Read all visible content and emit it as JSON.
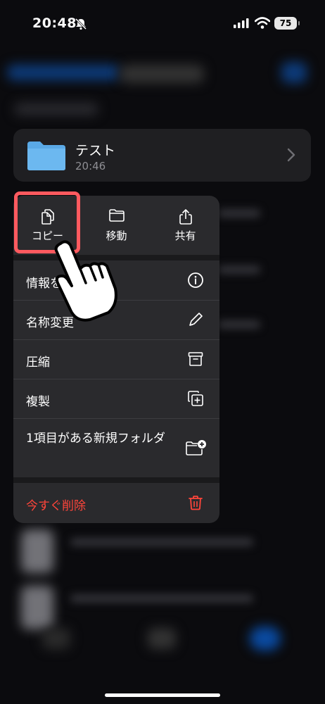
{
  "status_bar": {
    "time": "20:48",
    "battery": "75"
  },
  "folder": {
    "name": "テスト",
    "time": "20:46"
  },
  "menu": {
    "actions": [
      {
        "label": "コピー",
        "icon": "copy-icon"
      },
      {
        "label": "移動",
        "icon": "folder-icon"
      },
      {
        "label": "共有",
        "icon": "share-icon"
      }
    ],
    "items": [
      {
        "label": "情報を",
        "icon": "info-icon"
      },
      {
        "label": "名称変更",
        "icon": "pencil-icon"
      },
      {
        "label": "圧縮",
        "icon": "archive-icon"
      },
      {
        "label": "複製",
        "icon": "duplicate-icon"
      },
      {
        "label": "1項目がある新規フォルダ",
        "icon": "new-folder-icon"
      }
    ],
    "delete": {
      "label": "今すぐ削除",
      "icon": "trash-icon"
    }
  },
  "colors": {
    "accent": "#0a84ff",
    "danger": "#ff453a",
    "highlight": "#ff5a5f",
    "menu_bg": "#2a2a2d"
  }
}
